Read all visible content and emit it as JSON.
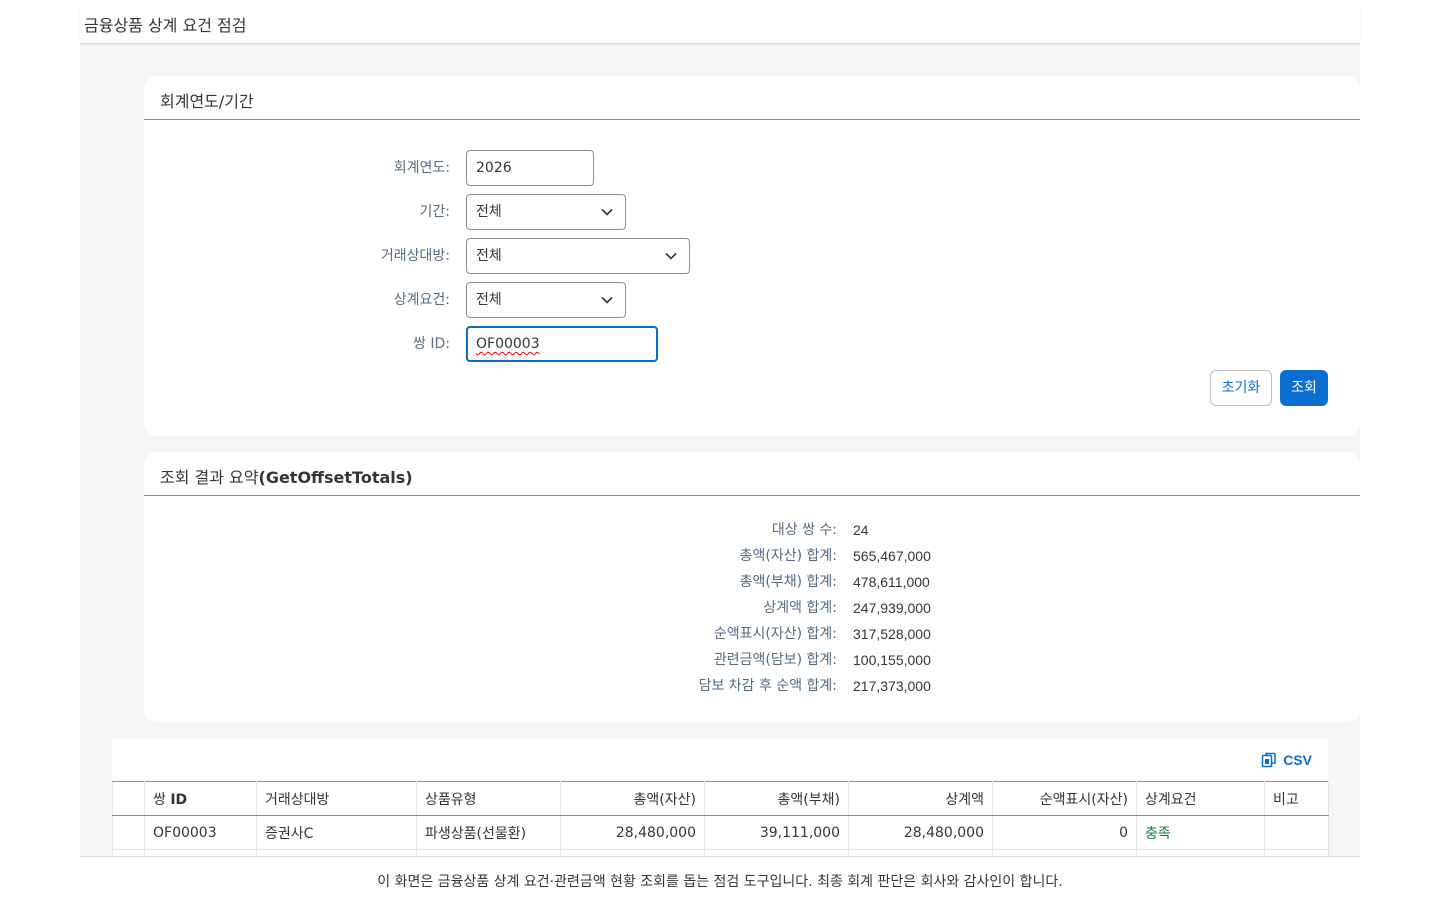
{
  "app": {
    "title": "금융상품 상계 요건 점검"
  },
  "filter": {
    "heading": "회계연도/기간",
    "fiscal_year": {
      "label": "회계연도:",
      "value": "2026"
    },
    "period": {
      "label": "기간:",
      "value": "전체"
    },
    "counterparty": {
      "label": "거래상대방:",
      "value": "전체"
    },
    "offset_req": {
      "label": "상계요건:",
      "value": "전체"
    },
    "pair_id": {
      "label": "쌍 ID:",
      "value": "OF00003"
    },
    "reset_label": "초기화",
    "search_label": "조회"
  },
  "summary": {
    "heading_prefix": "조회 결과 요약",
    "heading_suffix": "(GetOffsetTotals)",
    "rows": [
      {
        "label": "대상 쌍 수:",
        "value": "24"
      },
      {
        "label": "총액(자산) 합계:",
        "value": "565,467,000"
      },
      {
        "label": "총액(부채) 합계:",
        "value": "478,611,000"
      },
      {
        "label": "상계액 합계:",
        "value": "247,939,000"
      },
      {
        "label": "순액표시(자산) 합계:",
        "value": "317,528,000"
      },
      {
        "label": "관련금액(담보) 합계:",
        "value": "100,155,000"
      },
      {
        "label": "담보 차감 후 순액 합계:",
        "value": "217,373,000"
      }
    ]
  },
  "table": {
    "csv_label": "CSV",
    "columns": {
      "pair_prefix": "쌍",
      "pair_id": "ID",
      "counterparty": "거래상대방",
      "product": "상품유형",
      "gross_asset": "총액(자산)",
      "gross_liab": "총액(부채)",
      "offset": "상계액",
      "net_asset": "순액표시(자산)",
      "requirement": "상계요건",
      "note": "비고"
    },
    "rows": [
      {
        "pair_id": "OF00003",
        "counterparty": "증권사C",
        "product": "파생상품(선물환)",
        "gross_asset": "28,480,000",
        "gross_liab": "39,111,000",
        "offset": "28,480,000",
        "net_asset": "0",
        "requirement": "충족",
        "note": ""
      }
    ]
  },
  "footer": {
    "text": "이 화면은 금융상품 상계 요건·관련금액 현황 조회를 돕는 점검 도구입니다. 최종 회계 판단은 회사와 감사인이 합니다."
  },
  "colors": {
    "accent": "#0a6ed1",
    "ok": "#107e3e",
    "label": "#556b82"
  }
}
